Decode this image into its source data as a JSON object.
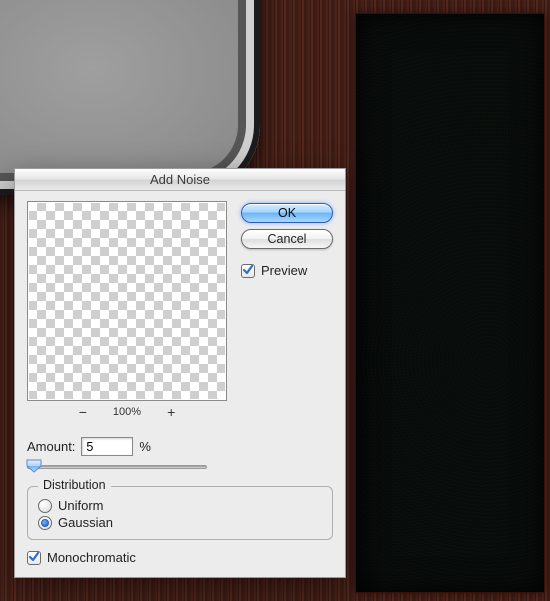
{
  "dialog": {
    "title": "Add Noise",
    "buttons": {
      "ok": "OK",
      "cancel": "Cancel"
    },
    "preview_label": "Preview",
    "preview_checked": true,
    "zoom": {
      "zoom_out": "−",
      "zoom_level": "100%",
      "zoom_in": "+"
    },
    "amount": {
      "label": "Amount:",
      "value": "5",
      "unit": "%",
      "slider_pos_pct": 4
    },
    "distribution": {
      "legend": "Distribution",
      "options": [
        {
          "label": "Uniform",
          "selected": false
        },
        {
          "label": "Gaussian",
          "selected": true
        }
      ]
    },
    "monochromatic": {
      "label": "Monochromatic",
      "checked": true
    }
  }
}
